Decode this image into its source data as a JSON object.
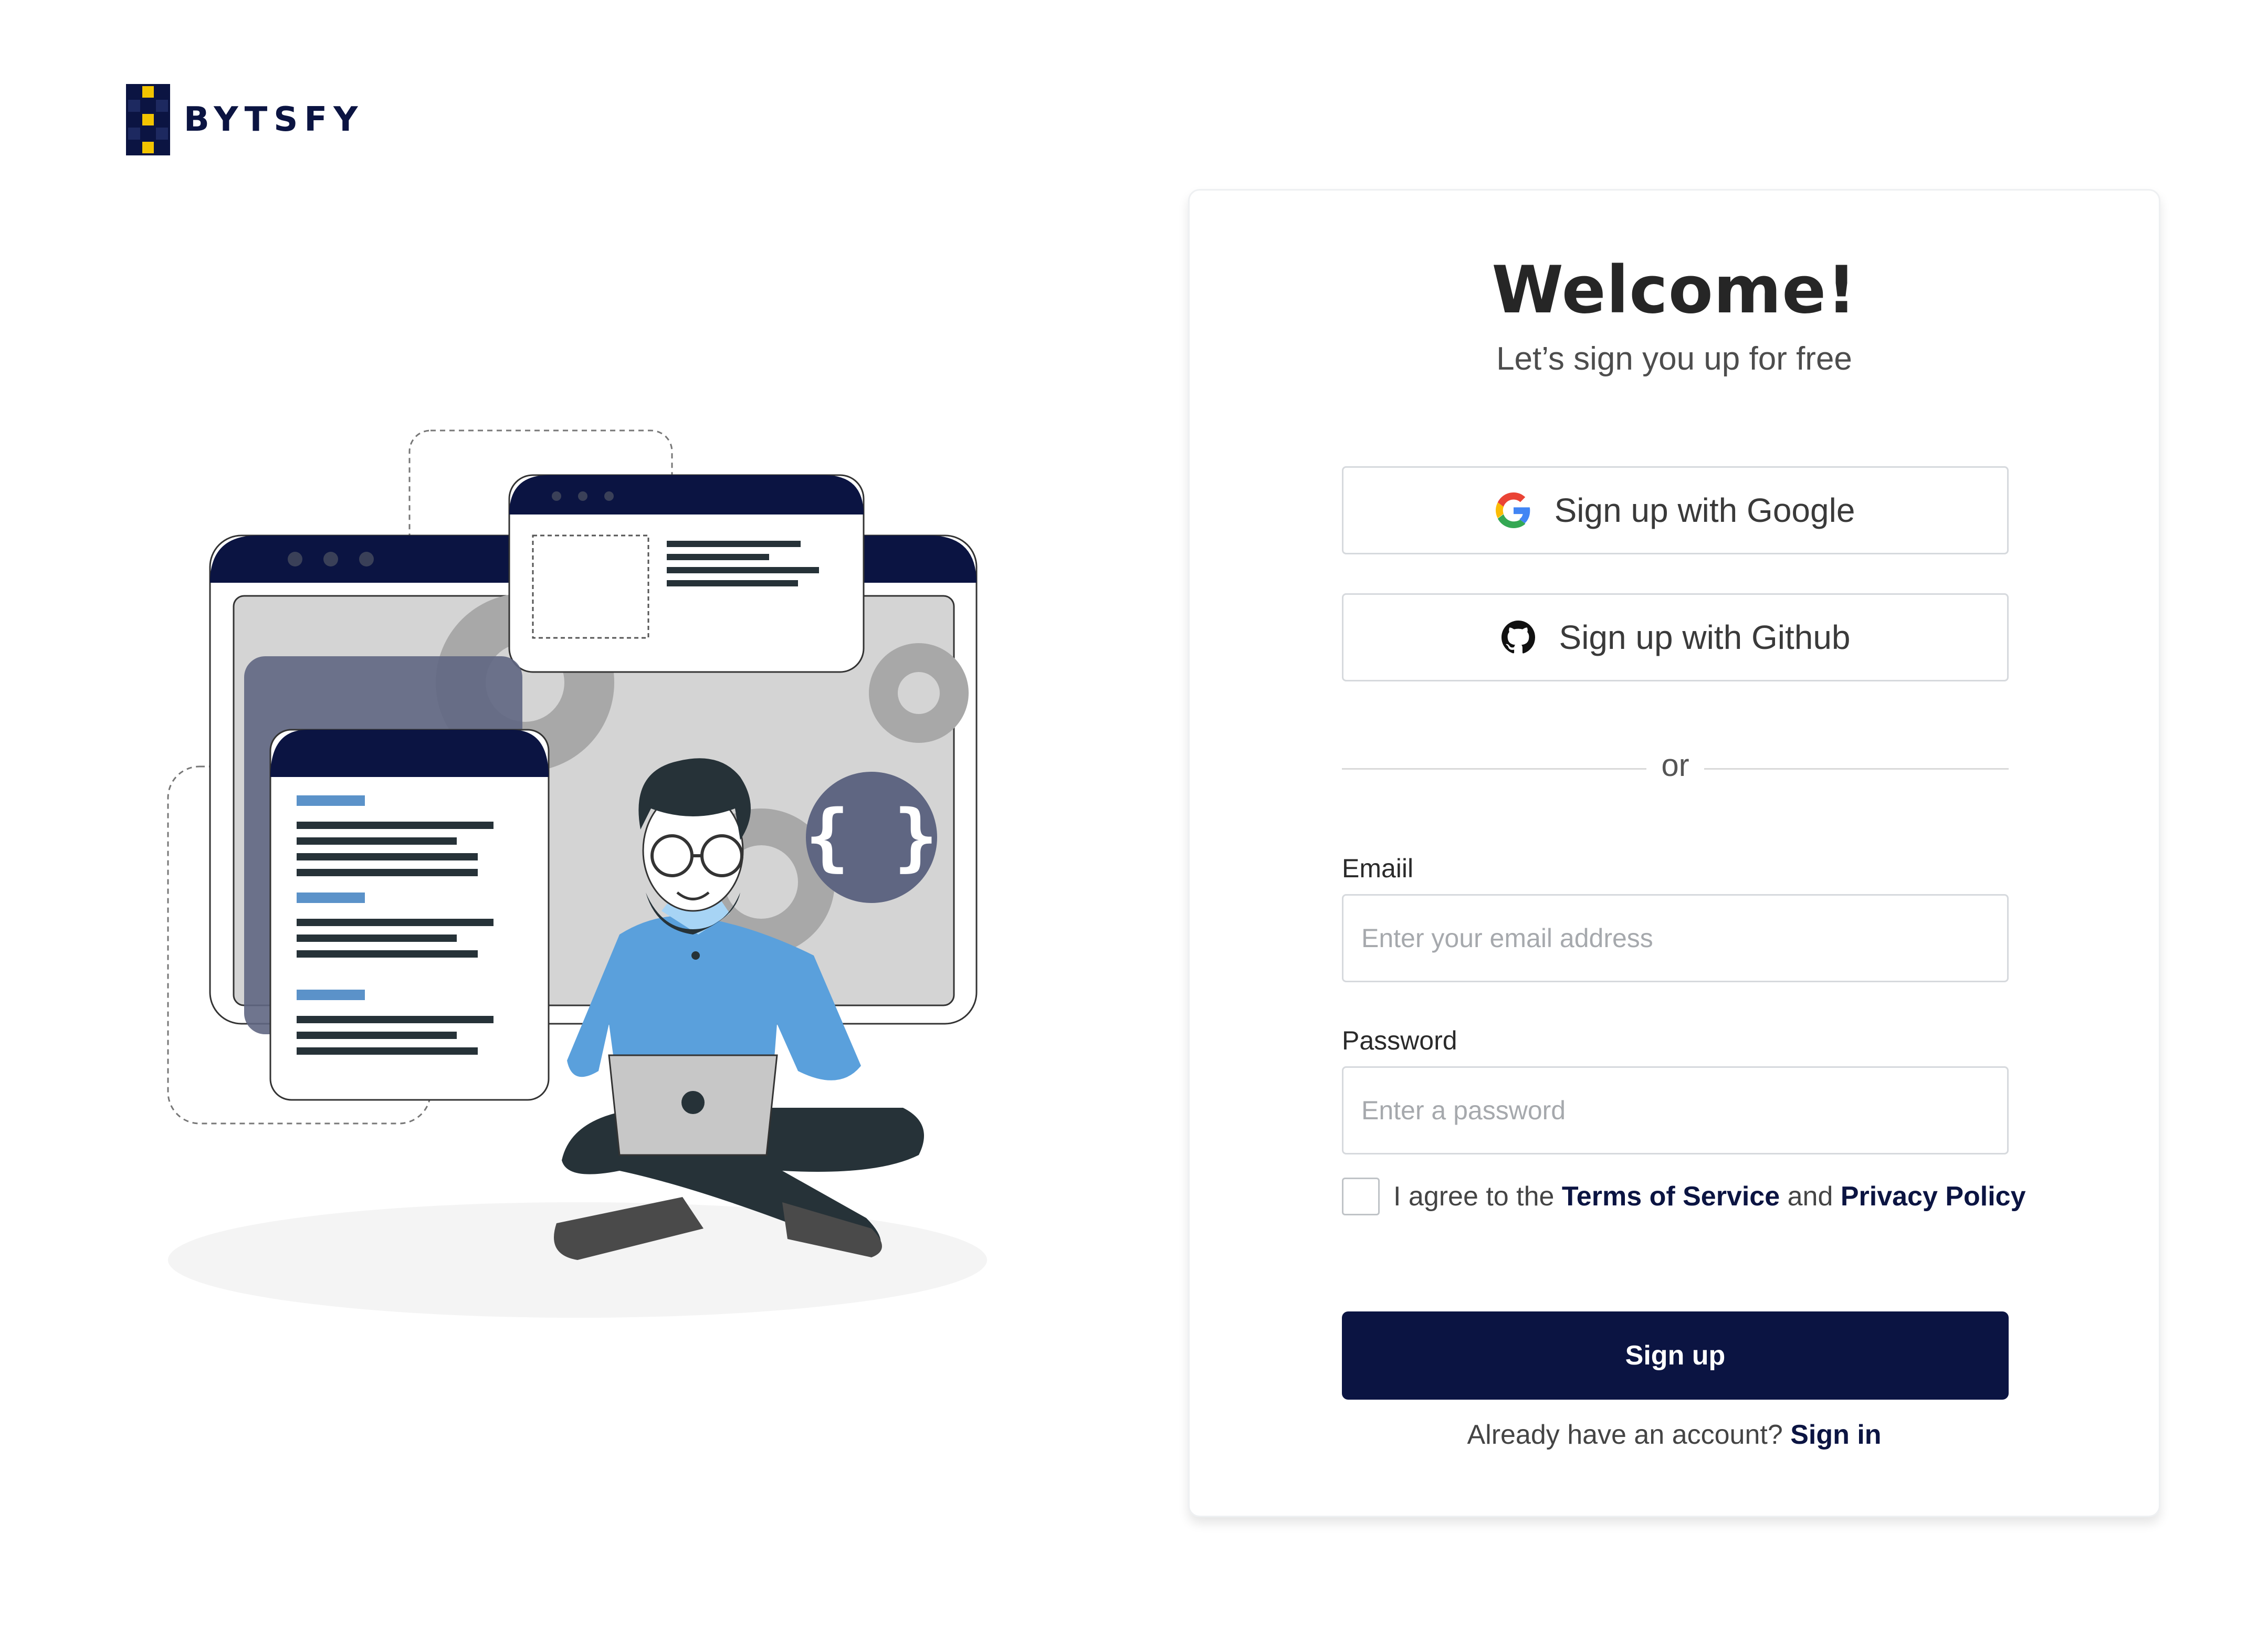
{
  "brand": {
    "name": "BYTSFY",
    "accent": "#0b1442",
    "logo_yellow": "#f2c400"
  },
  "card": {
    "title": "Welcome!",
    "subtitle": "Let’s sign you up for free",
    "google_label": "Sign up with Google",
    "github_label": "Sign up with Github",
    "divider_text": "or",
    "email": {
      "label": "Emaiil",
      "placeholder": "Enter your email address",
      "value": ""
    },
    "password": {
      "label": "Password",
      "placeholder": "Enter a password",
      "value": ""
    },
    "agree": {
      "prefix": "I agree to the",
      "terms": "Terms of Service",
      "and": "and",
      "privacy": "Privacy Policy",
      "checked": false
    },
    "submit_label": "Sign up",
    "signin": {
      "prompt": "Already have an account?",
      "link": "Sign in"
    }
  },
  "icons": [
    "google-icon",
    "github-icon"
  ]
}
